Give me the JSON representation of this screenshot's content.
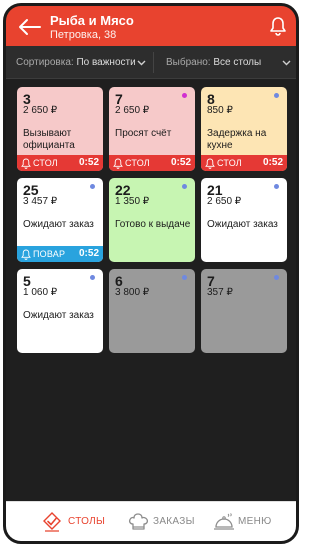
{
  "header": {
    "title": "Рыба и Мясо",
    "subtitle": "Петровка, 38",
    "color": "#e8432f"
  },
  "filters": {
    "sort_label": "Сортировка:",
    "sort_value": "По важности",
    "selected_label": "Выбрано:",
    "selected_value": "Все столы"
  },
  "tables": [
    {
      "number": "3",
      "price": "2 650 ₽",
      "status": "Вызывают официанта",
      "bg": "#f6c9c9",
      "dot": null,
      "bar": {
        "who": "СТОЛ",
        "time": "0:52",
        "color": "#e53935"
      }
    },
    {
      "number": "7",
      "price": "2 650 ₽",
      "status": "Просят счёт",
      "bg": "#f6c9c9",
      "dot": "#d12fd1",
      "bar": {
        "who": "СТОЛ",
        "time": "0:52",
        "color": "#e53935"
      }
    },
    {
      "number": "8",
      "price": "850 ₽",
      "status": "Задержка на кухне",
      "bg": "#fde5b4",
      "dot": "#6f89e0",
      "bar": {
        "who": "СТОЛ",
        "time": "0:52",
        "color": "#e53935"
      }
    },
    {
      "number": "25",
      "price": "3 457 ₽",
      "status": "Ожидают заказ",
      "bg": "#ffffff",
      "dot": "#6f89e0",
      "bar": {
        "who": "ПОВАР",
        "time": "0:52",
        "color": "#29a3de"
      }
    },
    {
      "number": "22",
      "price": "1 350 ₽",
      "status": "Готово к выдаче",
      "bg": "#c7f5b2",
      "dot": "#6f89e0",
      "bar": null
    },
    {
      "number": "21",
      "price": "2 650 ₽",
      "status": "Ожидают заказ",
      "bg": "#ffffff",
      "dot": "#6f89e0",
      "bar": null
    },
    {
      "number": "5",
      "price": "1 060 ₽",
      "status": "Ожидают заказ",
      "bg": "#ffffff",
      "dot": "#6f89e0",
      "bar": null
    },
    {
      "number": "6",
      "price": "3 800 ₽",
      "status": "",
      "bg": "#9a9a9a",
      "dot": "#6f89e0",
      "bar": null
    },
    {
      "number": "7",
      "price": "357 ₽",
      "status": "",
      "bg": "#9a9a9a",
      "dot": "#6f89e0",
      "bar": null
    }
  ],
  "nav": {
    "tables": {
      "label": "СТОЛЫ",
      "icon": "table-service-icon",
      "active": true
    },
    "orders": {
      "label": "ЗАКАЗЫ",
      "icon": "chef-hat-icon",
      "active": false
    },
    "menu": {
      "label": "МЕНЮ",
      "icon": "cloche-icon",
      "active": false
    }
  }
}
